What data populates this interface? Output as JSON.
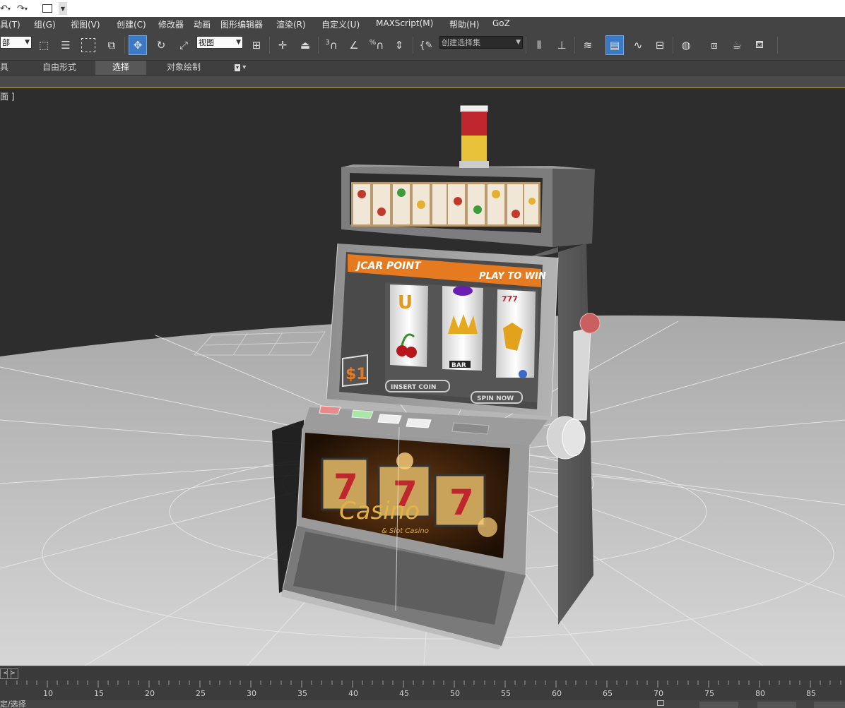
{
  "quick_access": {
    "undo_icon": "undo-icon",
    "redo_icon": "redo-icon",
    "window_icon": "window-icon"
  },
  "menu": [
    "具(T)",
    "组(G)",
    "视图(V)",
    "创建(C)",
    "修改器",
    "动画",
    "图形编辑器",
    "渲染(R)",
    "自定义(U)",
    "MAXScript(M)",
    "帮助(H)",
    "GoZ"
  ],
  "toolbar": {
    "selection_filter_value": "部",
    "reference_coord_value": "视图",
    "named_selection_placeholder": "创建选择集",
    "snap_3d_label": "3",
    "angle_snap_label": "%"
  },
  "ribbon": {
    "tabs": [
      "具",
      "自由形式",
      "选择",
      "对象绘制"
    ],
    "selected_tab": "选择"
  },
  "viewport": {
    "label": "面 ]",
    "texture": {
      "marquee_left": "JCAR POINT",
      "marquee_right": "PLAY TO WIN",
      "price_badge": "$1",
      "insert_coin": "INSERT COIN",
      "spin": "SPIN NOW",
      "reel_text": "BAR",
      "jackpot_number": "777",
      "cabinet_brand": "Casino",
      "cabinet_sub": "& Slot Casino"
    }
  },
  "timeline": {
    "prev_label": "<",
    "next_label": ">",
    "ticks": [
      "10",
      "15",
      "20",
      "25",
      "30",
      "35",
      "40",
      "45",
      "50",
      "55",
      "60",
      "65",
      "70",
      "75",
      "80",
      "85"
    ]
  },
  "status": {
    "text": "定/选择"
  }
}
